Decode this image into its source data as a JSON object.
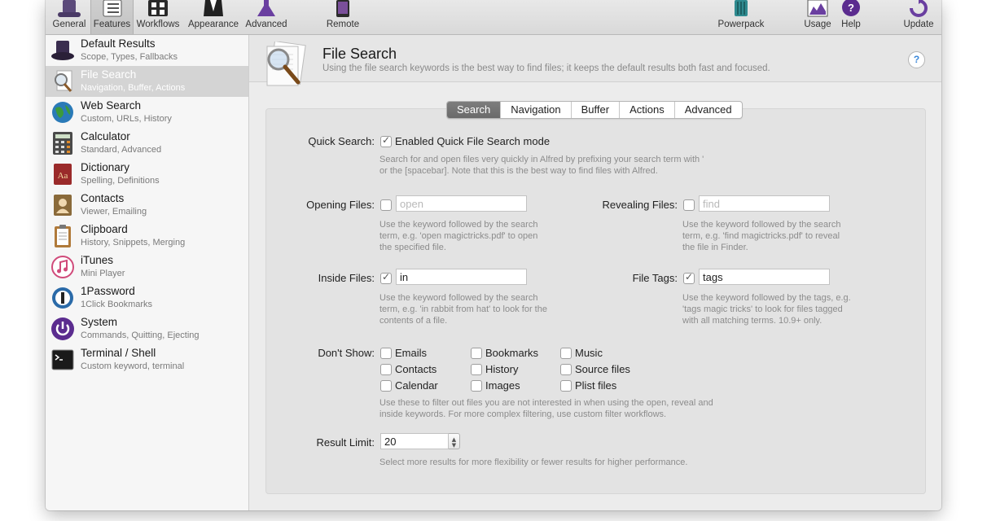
{
  "toolbar": {
    "items": [
      {
        "label": "General",
        "icon": "hat-icon"
      },
      {
        "label": "Features",
        "icon": "features-list-icon",
        "selected": true
      },
      {
        "label": "Workflows",
        "icon": "workflows-grid-icon"
      },
      {
        "label": "Appearance",
        "icon": "tuxedo-icon"
      },
      {
        "label": "Advanced",
        "icon": "flask-icon"
      },
      {
        "label": "Remote",
        "icon": "tablet-icon"
      },
      {
        "label": "Powerpack",
        "icon": "powerpack-icon"
      },
      {
        "label": "Usage",
        "icon": "usage-chart-icon"
      },
      {
        "label": "Help",
        "icon": "help-icon"
      },
      {
        "label": "Update",
        "icon": "update-icon"
      }
    ]
  },
  "sidebar": {
    "items": [
      {
        "title": "Default Results",
        "subtitle": "Scope, Types, Fallbacks",
        "icon": "hat-icon"
      },
      {
        "title": "File Search",
        "subtitle": "Navigation, Buffer, Actions",
        "icon": "magnifier-document-icon",
        "selected": true
      },
      {
        "title": "Web Search",
        "subtitle": "Custom, URLs, History",
        "icon": "globe-icon"
      },
      {
        "title": "Calculator",
        "subtitle": "Standard, Advanced",
        "icon": "calculator-icon"
      },
      {
        "title": "Dictionary",
        "subtitle": "Spelling, Definitions",
        "icon": "dictionary-icon"
      },
      {
        "title": "Contacts",
        "subtitle": "Viewer, Emailing",
        "icon": "contacts-book-icon"
      },
      {
        "title": "Clipboard",
        "subtitle": "History, Snippets, Merging",
        "icon": "clipboard-icon"
      },
      {
        "title": "iTunes",
        "subtitle": "Mini Player",
        "icon": "itunes-note-icon"
      },
      {
        "title": "1Password",
        "subtitle": "1Click Bookmarks",
        "icon": "onepassword-icon"
      },
      {
        "title": "System",
        "subtitle": "Commands, Quitting, Ejecting",
        "icon": "power-icon"
      },
      {
        "title": "Terminal / Shell",
        "subtitle": "Custom keyword, terminal",
        "icon": "terminal-icon"
      }
    ]
  },
  "header": {
    "title": "File Search",
    "description": "Using the file search keywords is the best way to find files; it keeps the default results both fast and focused.",
    "help": "?"
  },
  "tabs": [
    "Search",
    "Navigation",
    "Buffer",
    "Actions",
    "Advanced"
  ],
  "active_tab": "Search",
  "quick_search": {
    "label": "Quick Search:",
    "checkbox_label": "Enabled Quick File Search mode",
    "checked": true,
    "help_line1": "Search for and open files very quickly in Alfred by prefixing your search term with '",
    "help_line2": "or the [spacebar]. Note that this is the best way to find files with Alfred."
  },
  "opening_files": {
    "label": "Opening Files:",
    "checked": false,
    "placeholder": "open",
    "value": "",
    "help": [
      "Use the keyword followed by the search",
      "term, e.g. 'open magictricks.pdf' to open",
      "the specified file."
    ]
  },
  "revealing_files": {
    "label": "Revealing Files:",
    "checked": false,
    "placeholder": "find",
    "value": "",
    "help": [
      "Use the keyword followed by the search",
      "term, e.g. 'find magictricks.pdf' to reveal",
      "the file in Finder."
    ]
  },
  "inside_files": {
    "label": "Inside Files:",
    "checked": true,
    "value": "in",
    "help": [
      "Use the keyword followed by the search",
      "term, e.g. 'in rabbit from hat' to look for the",
      "contents of a file."
    ]
  },
  "file_tags": {
    "label": "File Tags:",
    "checked": true,
    "value": "tags",
    "help": [
      "Use the keyword followed by the tags, e.g.",
      "'tags magic tricks' to look for files tagged",
      "with all matching terms. 10.9+ only."
    ]
  },
  "dont_show": {
    "label": "Don't Show:",
    "options": [
      "Emails",
      "Bookmarks",
      "Music",
      "Contacts",
      "History",
      "Source files",
      "Calendar",
      "Images",
      "Plist files"
    ],
    "help_line1": "Use these to filter out files you are not interested in when using the open, reveal and",
    "help_line2": "inside keywords. For more complex filtering, use custom filter workflows."
  },
  "result_limit": {
    "label": "Result Limit:",
    "value": "20",
    "help": "Select more results for more flexibility or fewer results for higher performance."
  },
  "colors": {
    "selected_sidebar": "#d4d4d4",
    "active_tab": "#6f6f6f",
    "help_accent": "#3c88d9"
  }
}
